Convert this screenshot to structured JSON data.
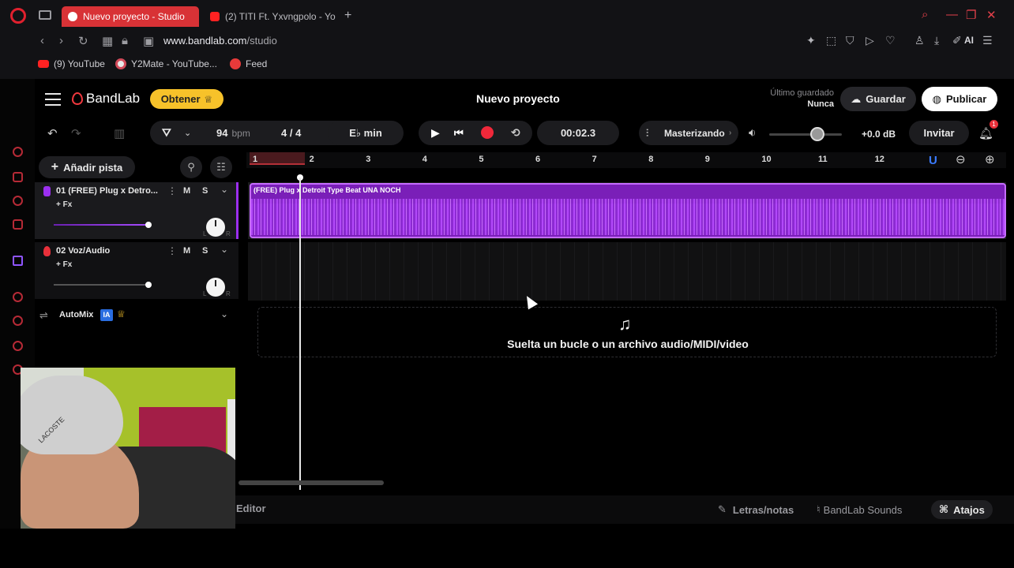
{
  "browser": {
    "tabs": [
      {
        "title": "Nuevo proyecto - Studio",
        "active": true
      },
      {
        "title": "(2) TITI Ft. Yxvngpolo - Yo",
        "active": false
      }
    ],
    "url_domain": "www.bandlab.com",
    "url_path": "/studio",
    "ai_label": "AI",
    "bookmarks": [
      "(9) YouTube",
      "Y2Mate - YouTube...",
      "Feed"
    ]
  },
  "header": {
    "logo": "BandLab",
    "obtener": "Obtener",
    "project_title": "Nuevo proyecto",
    "last_saved_label": "Último guardado",
    "last_saved_value": "Nunca",
    "save": "Guardar",
    "publish": "Publicar"
  },
  "toolbar": {
    "bpm": "94",
    "bpm_unit": "bpm",
    "time_signature": "4 / 4",
    "key": "E♭ min",
    "time": "00:02.3",
    "mastering": "Masterizando",
    "gain": "+0.0 dB",
    "invite": "Invitar",
    "notifications": "1"
  },
  "tracks_panel": {
    "add_track": "Añadir pista",
    "tracks": [
      {
        "name": "01  (FREE) Plug x Detro...",
        "fx": "+ Fx",
        "mute": "M",
        "solo": "S",
        "color": "#9b2ff0",
        "volume": 0.9
      },
      {
        "name": "02  Voz/Audio",
        "fx": "+ Fx",
        "mute": "M",
        "solo": "S",
        "color": "#e8303a",
        "volume": 0.9
      }
    ],
    "automix": "AutoMix",
    "automix_badge": "IA"
  },
  "timeline": {
    "bars": [
      "1",
      "2",
      "3",
      "4",
      "5",
      "6",
      "7",
      "8",
      "9",
      "10",
      "11",
      "12"
    ],
    "clip_name": "(FREE) Plug x Detroit Type Beat UNA NOCH",
    "drop_text": "Suelta un bucle o un archivo audio/MIDI/video"
  },
  "bottombar": {
    "editor": "Editor",
    "lyrics": "Letras/notas",
    "sounds": "BandLab Sounds",
    "shortcuts": "Atajos"
  },
  "colors": {
    "accent": "#9b2ff0",
    "record": "#f0283a",
    "obtener": "#f7c22a",
    "browser_tab_active": "#d83236"
  }
}
